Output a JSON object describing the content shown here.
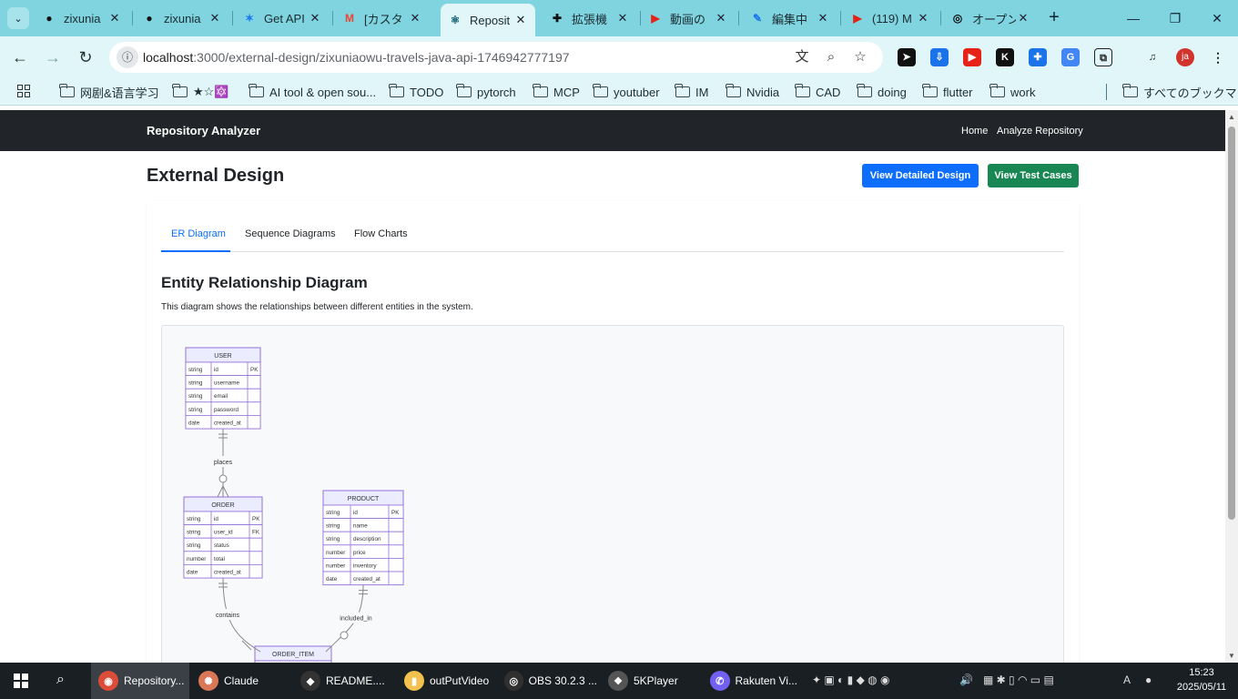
{
  "browser": {
    "tabs": [
      {
        "title": "zixunia",
        "icon": "github-icon"
      },
      {
        "title": "zixunia",
        "icon": "github-icon"
      },
      {
        "title": "Get API",
        "icon": "butterfly-icon"
      },
      {
        "title": "[カスタ",
        "icon": "gmail-icon"
      },
      {
        "title": "Reposit",
        "icon": "react-icon",
        "active": true
      },
      {
        "title": "拡張機",
        "icon": "puzzle-icon"
      },
      {
        "title": "動画の",
        "icon": "youtube-icon"
      },
      {
        "title": "編集中",
        "icon": "feather-icon"
      },
      {
        "title": "(119) M",
        "icon": "youtube-icon"
      },
      {
        "title": "オープン",
        "icon": "openai-icon"
      }
    ],
    "url_host": "localhost",
    "url_path": ":3000/external-design/zixuniaowu-travels-java-api-1746942777197",
    "profile_initials": "ja",
    "bookmarks": [
      "网剧&语言学习",
      "★☆🔯",
      "AI tool & open sou...",
      "TODO",
      "pytorch",
      "MCP",
      "youtuber",
      "IM",
      "Nvidia",
      "CAD",
      "doing",
      "flutter",
      "work"
    ],
    "all_bookmarks": "すべてのブックマーク"
  },
  "page": {
    "brand": "Repository Analyzer",
    "nav": {
      "home": "Home",
      "analyze": "Analyze Repository"
    },
    "title": "External Design",
    "btn_detailed": "View Detailed Design",
    "btn_tests": "View Test Cases",
    "tabs": [
      "ER Diagram",
      "Sequence Diagrams",
      "Flow Charts"
    ],
    "active_tab": "ER Diagram",
    "section_title": "Entity Relationship Diagram",
    "section_desc": "This diagram shows the relationships between different entities in the system."
  },
  "er_diagram": {
    "entities": [
      {
        "name": "USER",
        "rows": [
          [
            "string",
            "id",
            "PK"
          ],
          [
            "string",
            "username",
            ""
          ],
          [
            "string",
            "email",
            ""
          ],
          [
            "string",
            "password",
            ""
          ],
          [
            "date",
            "created_at",
            ""
          ]
        ]
      },
      {
        "name": "ORDER",
        "rows": [
          [
            "string",
            "id",
            "PK"
          ],
          [
            "string",
            "user_id",
            "FK"
          ],
          [
            "string",
            "status",
            ""
          ],
          [
            "number",
            "total",
            ""
          ],
          [
            "date",
            "created_at",
            ""
          ]
        ]
      },
      {
        "name": "PRODUCT",
        "rows": [
          [
            "string",
            "id",
            "PK"
          ],
          [
            "string",
            "name",
            ""
          ],
          [
            "string",
            "description",
            ""
          ],
          [
            "number",
            "price",
            ""
          ],
          [
            "number",
            "inventory",
            ""
          ],
          [
            "date",
            "created_at",
            ""
          ]
        ]
      },
      {
        "name": "ORDER_ITEM",
        "rows": []
      }
    ],
    "relationships": [
      {
        "label": "places",
        "from": "USER",
        "to": "ORDER"
      },
      {
        "label": "contains",
        "from": "ORDER",
        "to": "ORDER_ITEM"
      },
      {
        "label": "included_in",
        "from": "PRODUCT",
        "to": "ORDER_ITEM"
      }
    ],
    "colors": {
      "header": "#ececff",
      "border": "#9370db",
      "line": "#888888",
      "label": "#333333"
    }
  },
  "taskbar": {
    "apps": [
      {
        "label": "Repository...",
        "icon": "chrome-icon",
        "active": true
      },
      {
        "label": "Claude",
        "icon": "claude-icon"
      },
      {
        "label": "README....",
        "icon": "unity-icon"
      },
      {
        "label": "outPutVideo",
        "icon": "folder-icon"
      },
      {
        "label": "OBS 30.2.3 ...",
        "icon": "obs-icon"
      },
      {
        "label": "5KPlayer",
        "icon": "5kplayer-icon"
      },
      {
        "label": "Rakuten Vi...",
        "icon": "viber-icon"
      }
    ],
    "ime": "A",
    "time": "15:23",
    "date": "2025/05/11"
  }
}
